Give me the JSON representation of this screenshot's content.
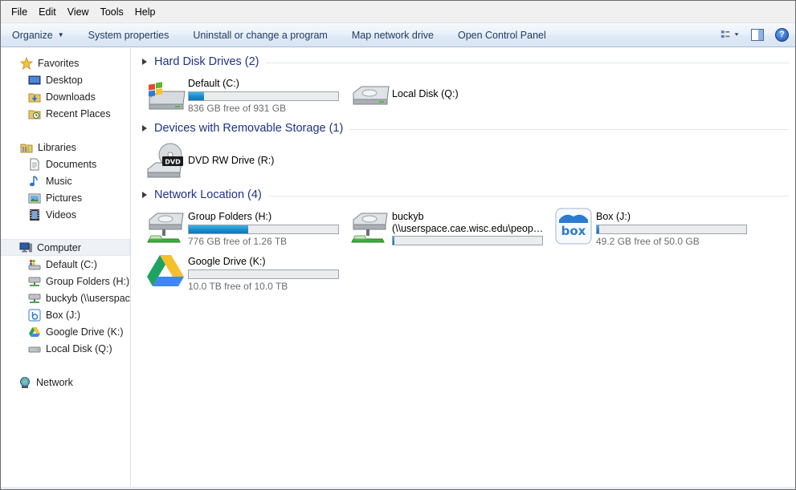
{
  "menu": [
    "File",
    "Edit",
    "View",
    "Tools",
    "Help"
  ],
  "toolbar": {
    "organize": "Organize",
    "system_properties": "System properties",
    "uninstall": "Uninstall or change a program",
    "map_drive": "Map network drive",
    "control_panel": "Open Control Panel",
    "help": "?"
  },
  "nav": {
    "favorites": "Favorites",
    "desktop": "Desktop",
    "downloads": "Downloads",
    "recent": "Recent Places",
    "libraries": "Libraries",
    "documents": "Documents",
    "music": "Music",
    "pictures": "Pictures",
    "videos": "Videos",
    "computer": "Computer",
    "default_c": "Default (C:)",
    "group_h": "Group Folders (H:)",
    "buckyb": "buckyb (\\\\userspace",
    "box_j": "Box (J:)",
    "gdrive_k": "Google Drive (K:)",
    "local_q": "Local Disk (Q:)",
    "network": "Network"
  },
  "groups": {
    "hdd": "Hard Disk Drives (2)",
    "removable": "Devices with Removable Storage (1)",
    "network": "Network Location (4)"
  },
  "drives": {
    "c": {
      "name": "Default (C:)",
      "free": "836 GB free of 931 GB",
      "used_fraction": 0.1
    },
    "q": {
      "name": "Local Disk (Q:)"
    },
    "r": {
      "name": "DVD RW Drive (R:)",
      "label": "DVD"
    },
    "h": {
      "name": "Group Folders (H:)",
      "free": "776 GB free of 1.26 TB",
      "used_fraction": 0.4
    },
    "bucky": {
      "name": "buckyb",
      "path": "(\\\\userspace.cae.wisc.edu\\people...",
      "used_fraction": 0.01
    },
    "j": {
      "name": "Box (J:)",
      "free": "49.2 GB free of 50.0 GB",
      "used_fraction": 0.016,
      "logo": "box"
    },
    "k": {
      "name": "Google Drive (K:)",
      "free": "10.0 TB free of 10.0 TB",
      "used_fraction": 0.0
    }
  },
  "colors": {
    "accent": "#1e3287",
    "bar": "#1a8fcf"
  }
}
